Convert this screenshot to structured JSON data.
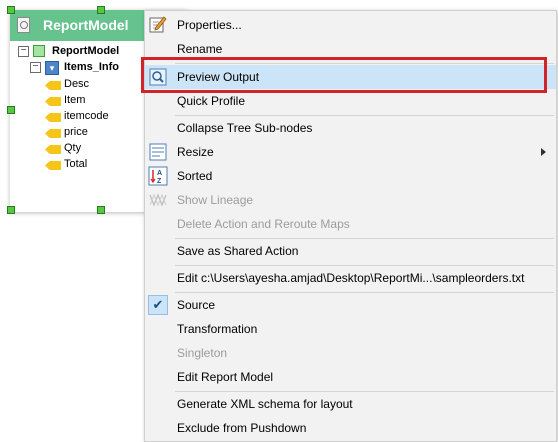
{
  "node": {
    "title": "ReportModel",
    "tree_root": "ReportModel",
    "group": "Items_Info",
    "fields": [
      "Desc",
      "Item",
      "itemcode",
      "price",
      "Qty",
      "Total"
    ]
  },
  "menu": {
    "items": [
      {
        "label": "Properties...",
        "icon": "edit-pencil-icon"
      },
      {
        "label": "Rename"
      },
      {
        "label": "Preview Output",
        "icon": "magnifier-icon",
        "highlighted": true
      },
      {
        "label": "Quick Profile"
      },
      {
        "label": "Collapse Tree Sub-nodes"
      },
      {
        "label": "Resize",
        "icon": "resize-icon",
        "submenu": true
      },
      {
        "label": "Sorted",
        "icon": "sort-az-icon"
      },
      {
        "label": "Show Lineage",
        "icon": "lineage-icon",
        "disabled": true
      },
      {
        "label": "Delete Action and Reroute Maps",
        "disabled": true
      },
      {
        "label": "Save as Shared Action"
      },
      {
        "label": "Edit c:\\Users\\ayesha.amjad\\Desktop\\ReportMi...\\sampleorders.txt"
      },
      {
        "label": "Source",
        "checked": true
      },
      {
        "label": "Transformation"
      },
      {
        "label": "Singleton",
        "disabled": true
      },
      {
        "label": "Edit Report Model"
      },
      {
        "label": "Generate XML schema for layout"
      },
      {
        "label": "Exclude from Pushdown"
      }
    ]
  },
  "colors": {
    "header_green": "#66c38e",
    "highlight_blue": "#cce4f7",
    "callout_red": "#d1232a"
  }
}
